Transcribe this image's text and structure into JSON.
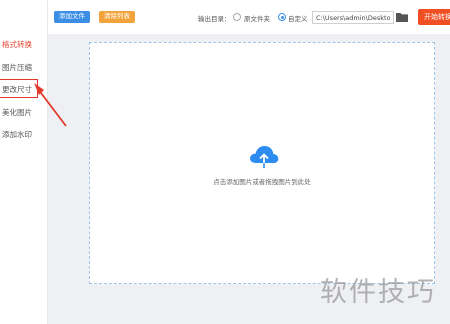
{
  "sidebar": {
    "items": [
      {
        "label": "格式转换",
        "active": true
      },
      {
        "label": "图片压缩",
        "active": false
      },
      {
        "label": "更改尺寸",
        "active": false
      },
      {
        "label": "美化图片",
        "active": false
      },
      {
        "label": "添加水印",
        "active": false
      }
    ]
  },
  "toolbar": {
    "add_files": "添加文件",
    "clear_list": "清除列表",
    "output_label": "输出目录：",
    "radio_original": "原文件夹",
    "radio_custom": "自定义",
    "output_path": "C:\\Users\\admin\\Deskto",
    "start_button": "开始转换"
  },
  "dropzone": {
    "hint": "点击添加图片或者拖拽图片到此处"
  },
  "watermark": "软件技巧",
  "colors": {
    "accent": "#3a8ee6",
    "warn": "#f2a33c",
    "danger": "#e8442e",
    "start": "#f04e23"
  },
  "icons": [
    "cloud-upload-icon",
    "folder-icon",
    "arrow-annotation"
  ]
}
